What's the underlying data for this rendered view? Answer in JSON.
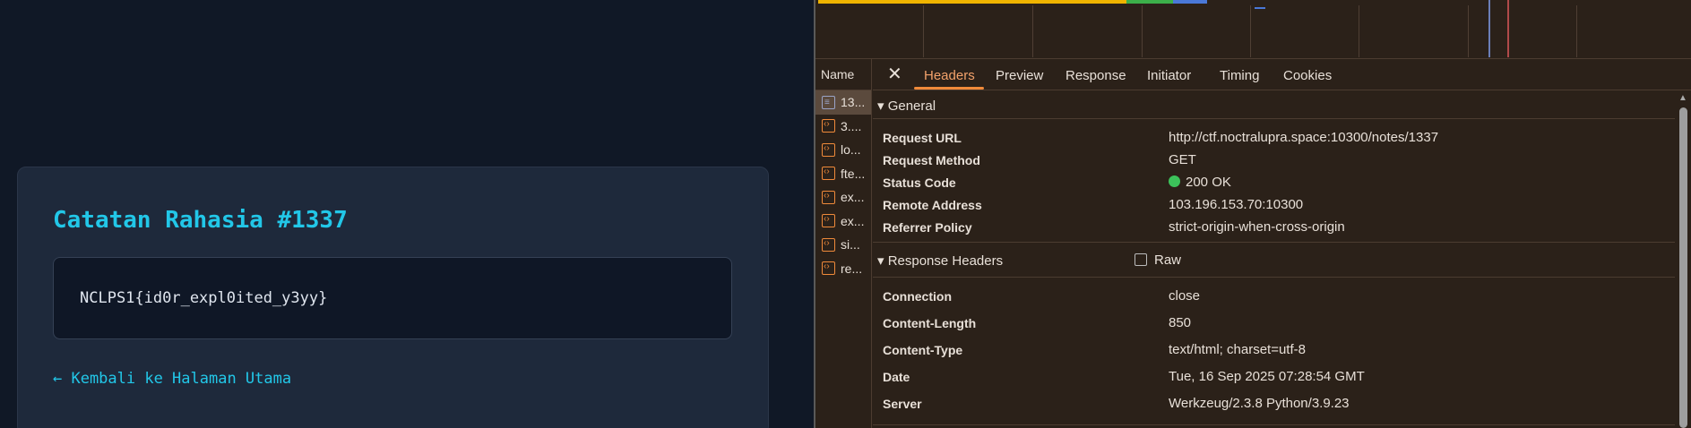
{
  "page": {
    "title": "Catatan Rahasia #1337",
    "note": "NCLPS1{id0r_expl0ited_y3yy}",
    "back_link": "← Kembali ke Halaman Utama"
  },
  "devtools": {
    "name_header": "Name",
    "requests": [
      {
        "label": "13...",
        "icon": "document-icon",
        "selected": true
      },
      {
        "label": "3....",
        "icon": "script-icon"
      },
      {
        "label": "lo...",
        "icon": "script-icon"
      },
      {
        "label": "fte...",
        "icon": "script-icon"
      },
      {
        "label": "ex...",
        "icon": "script-icon"
      },
      {
        "label": "ex...",
        "icon": "script-icon"
      },
      {
        "label": "si...",
        "icon": "script-icon"
      },
      {
        "label": "re...",
        "icon": "script-icon"
      }
    ],
    "tabs": [
      "Headers",
      "Preview",
      "Response",
      "Initiator",
      "Timing",
      "Cookies"
    ],
    "active_tab": "Headers",
    "general": {
      "title": "▾ General",
      "rows": [
        {
          "key": "Request URL",
          "value": "http://ctf.noctralupra.space:10300/notes/1337"
        },
        {
          "key": "Request Method",
          "value": "GET"
        },
        {
          "key": "Status Code",
          "value": "200 OK"
        },
        {
          "key": "Remote Address",
          "value": "103.196.153.70:10300"
        },
        {
          "key": "Referrer Policy",
          "value": "strict-origin-when-cross-origin"
        }
      ]
    },
    "response_headers": {
      "title": "▾ Response Headers",
      "raw_label": "Raw",
      "rows": [
        {
          "key": "Connection",
          "value": "close"
        },
        {
          "key": "Content-Length",
          "value": "850"
        },
        {
          "key": "Content-Type",
          "value": "text/html; charset=utf-8"
        },
        {
          "key": "Date",
          "value": "Tue, 16 Sep 2025 07:28:54 GMT"
        },
        {
          "key": "Server",
          "value": "Werkzeug/2.3.8 Python/3.9.23"
        }
      ]
    },
    "colors": {
      "accent": "#f08a3a",
      "status_ok": "#3cc25a",
      "page_accent": "#22c7e8"
    }
  }
}
